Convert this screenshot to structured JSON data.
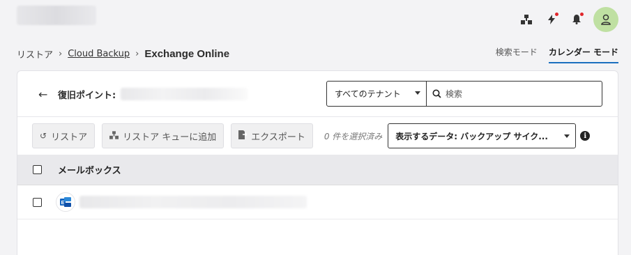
{
  "header": {
    "icons": [
      "org-icon",
      "bolt-icon",
      "bell-icon",
      "user-avatar"
    ],
    "colors": {
      "notification_dot": "#e0262b",
      "avatar_bg": "#bfe0a2",
      "accent": "#1b6fbe"
    }
  },
  "breadcrumb": {
    "items": [
      "リストア",
      "Cloud Backup",
      "Exchange Online"
    ]
  },
  "modes": {
    "search_mode": "検索モード",
    "calendar_mode": "カレンダー モード"
  },
  "restore_point": {
    "label": "復旧ポイント:"
  },
  "tenant_select": {
    "value": "すべてのテナント"
  },
  "search": {
    "placeholder": "検索"
  },
  "toolbar": {
    "restore_label": "リストア",
    "add_queue_label": "リストア キューに追加",
    "export_label": "エクスポート",
    "selected_count": "0 件を選択済み",
    "data_select_value": "表示するデータ: バックアップ サイク..."
  },
  "table": {
    "column_header": "メールボックス"
  }
}
